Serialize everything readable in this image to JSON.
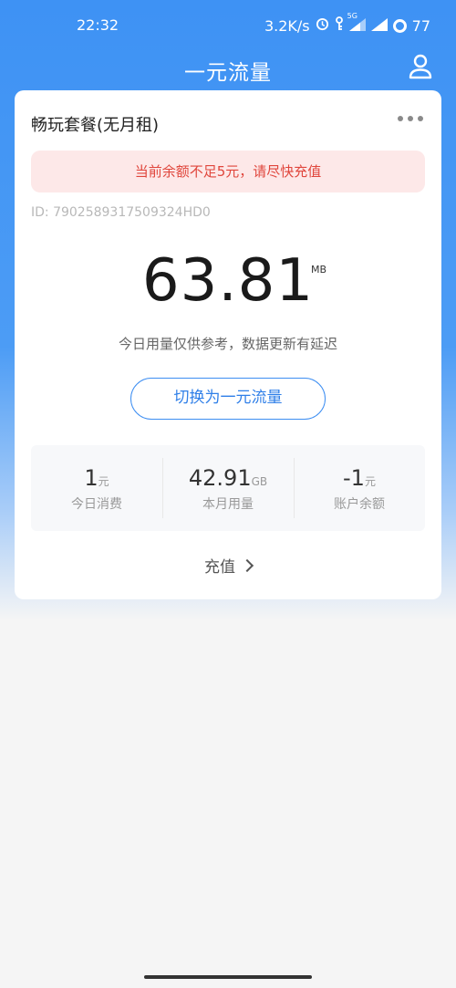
{
  "status_bar": {
    "time": "22:32",
    "speed": "3.2K/s",
    "network": "5G",
    "battery": "77"
  },
  "header": {
    "title": "一元流量"
  },
  "card": {
    "plan_name": "畅玩套餐(无月租)",
    "warning": "当前余额不足5元，请尽快充值",
    "id_text": "ID: 7902589317509324HD0",
    "usage_value": "63.81",
    "usage_unit": "MB",
    "usage_note": "今日用量仅供参考，数据更新有延迟",
    "switch_button": "切换为一元流量",
    "stats": [
      {
        "value": "1",
        "unit": "元",
        "label": "今日消费"
      },
      {
        "value": "42.91",
        "unit": "GB",
        "label": "本月用量"
      },
      {
        "value": "-1",
        "unit": "元",
        "label": "账户余额"
      }
    ],
    "recharge_label": "充值"
  },
  "colors": {
    "primary": "#3e92f4",
    "warning_text": "#e0463c",
    "warning_bg": "#fde8e8",
    "button_border": "#3d8ef2"
  }
}
